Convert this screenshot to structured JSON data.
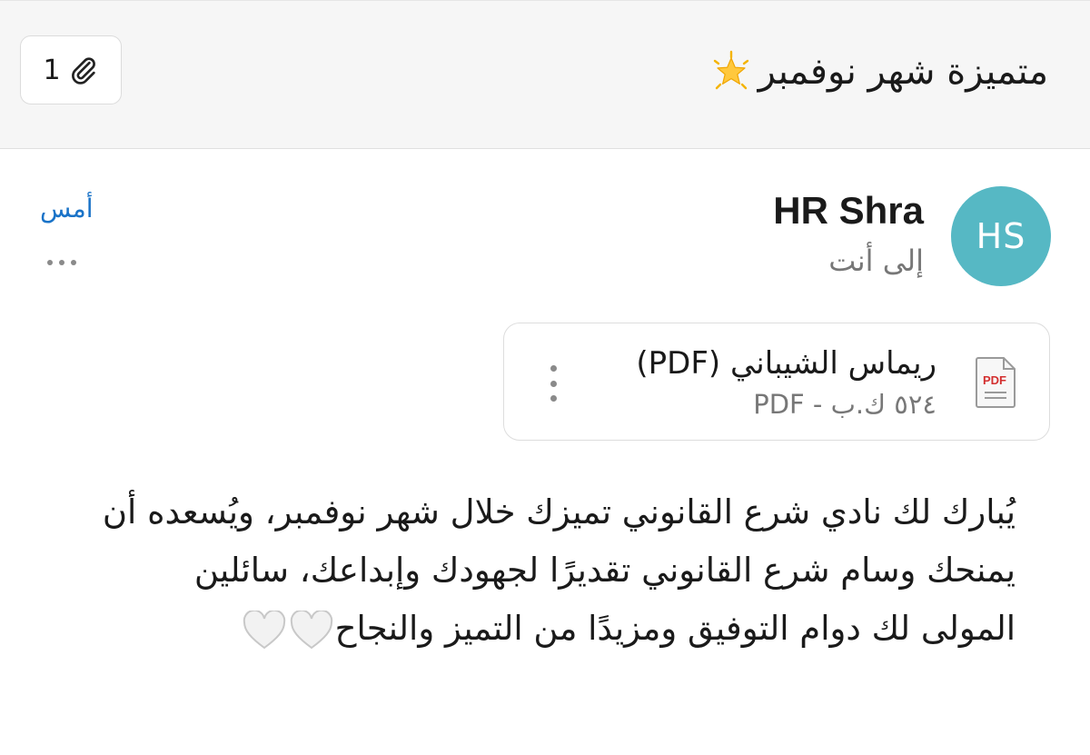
{
  "header": {
    "attachment_count": "1",
    "subject": "متميزة شهر نوفمبر"
  },
  "message": {
    "avatar_initials": "HS",
    "sender": "HR Shra",
    "recipient": "إلى أنت",
    "date": "أمس"
  },
  "attachment": {
    "name": "ريماس الشيباني (PDF)",
    "meta": "٥٢٤ ك.ب - PDF",
    "icon_label": "PDF"
  },
  "body": {
    "line1": "يُبارك لك نادي شرع القانوني تميزك خلال شهر نوفمبر، ويُسعده أن",
    "line2": "يمنحك وسام شرع القانوني تقديرًا لجهودك وإبداعك، سائلين",
    "line3": "المولى لك دوام التوفيق ومزيدًا من التميز والنجاح"
  },
  "colors": {
    "avatar": "#56b8c4",
    "date": "#1a73c8",
    "header_bg": "#f6f6f6"
  }
}
